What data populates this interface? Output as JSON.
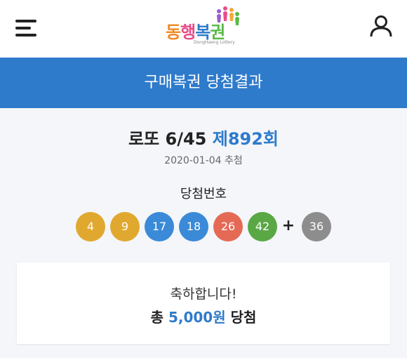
{
  "header": {
    "menu_icon": "hamburger-menu-icon",
    "logo": {
      "text": "동행복권",
      "subtext": "DongHaeng Lottery"
    },
    "user_icon": "user-icon"
  },
  "banner": {
    "title": "구매복권 당첨결과"
  },
  "game": {
    "name": "로또 6/45",
    "round": "제892회",
    "draw_date": "2020-01-04 추첨"
  },
  "winning_numbers": {
    "label": "당첨번호",
    "numbers": [
      {
        "value": "4",
        "color": "#e1a82f"
      },
      {
        "value": "9",
        "color": "#e1a82f"
      },
      {
        "value": "17",
        "color": "#3a8ad8"
      },
      {
        "value": "18",
        "color": "#3a8ad8"
      },
      {
        "value": "26",
        "color": "#e56a55"
      },
      {
        "value": "42",
        "color": "#5aa845"
      }
    ],
    "plus": "+",
    "bonus": {
      "value": "36",
      "color": "#8d8d8d"
    }
  },
  "result": {
    "congrats": "축하합니다!",
    "prefix": "총",
    "amount": "5,000원",
    "suffix": "당첨"
  },
  "colors": {
    "accent": "#2f7bcb",
    "background": "#f4f6fa"
  }
}
